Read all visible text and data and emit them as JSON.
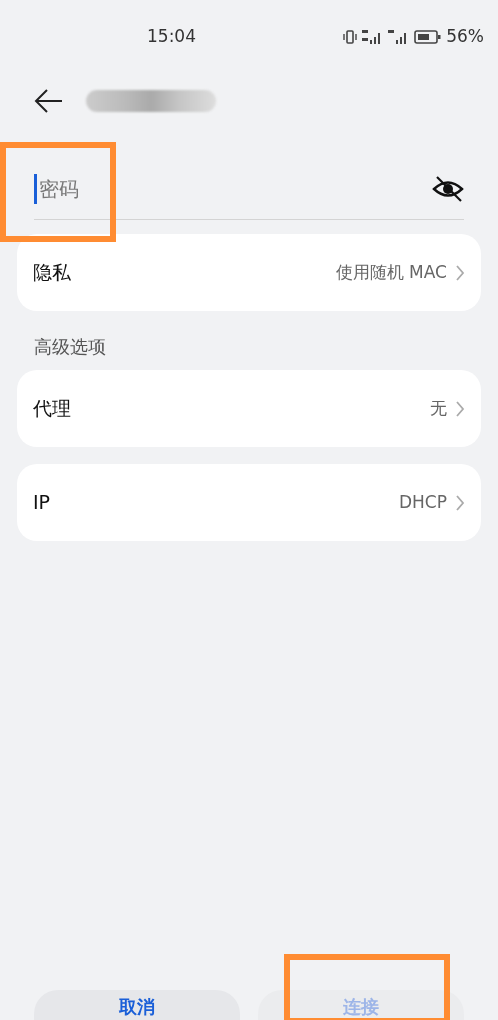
{
  "status_bar": {
    "time": "15:04",
    "battery": "56%"
  },
  "header": {
    "redacted_title": true
  },
  "password_field": {
    "placeholder": "密码",
    "focused": true,
    "visible": false
  },
  "settings": [
    {
      "label": "隐私",
      "value": "使用随机 MAC"
    }
  ],
  "section_title": "高级选项",
  "advanced": [
    {
      "label": "代理",
      "value": "无"
    },
    {
      "label": "IP",
      "value": "DHCP"
    }
  ],
  "buttons": [
    {
      "label": "取消",
      "disabled": false
    },
    {
      "label": "连接",
      "disabled": true
    }
  ],
  "annotations": [
    {
      "kind": "highlight"
    },
    {
      "kind": "highlight"
    }
  ]
}
